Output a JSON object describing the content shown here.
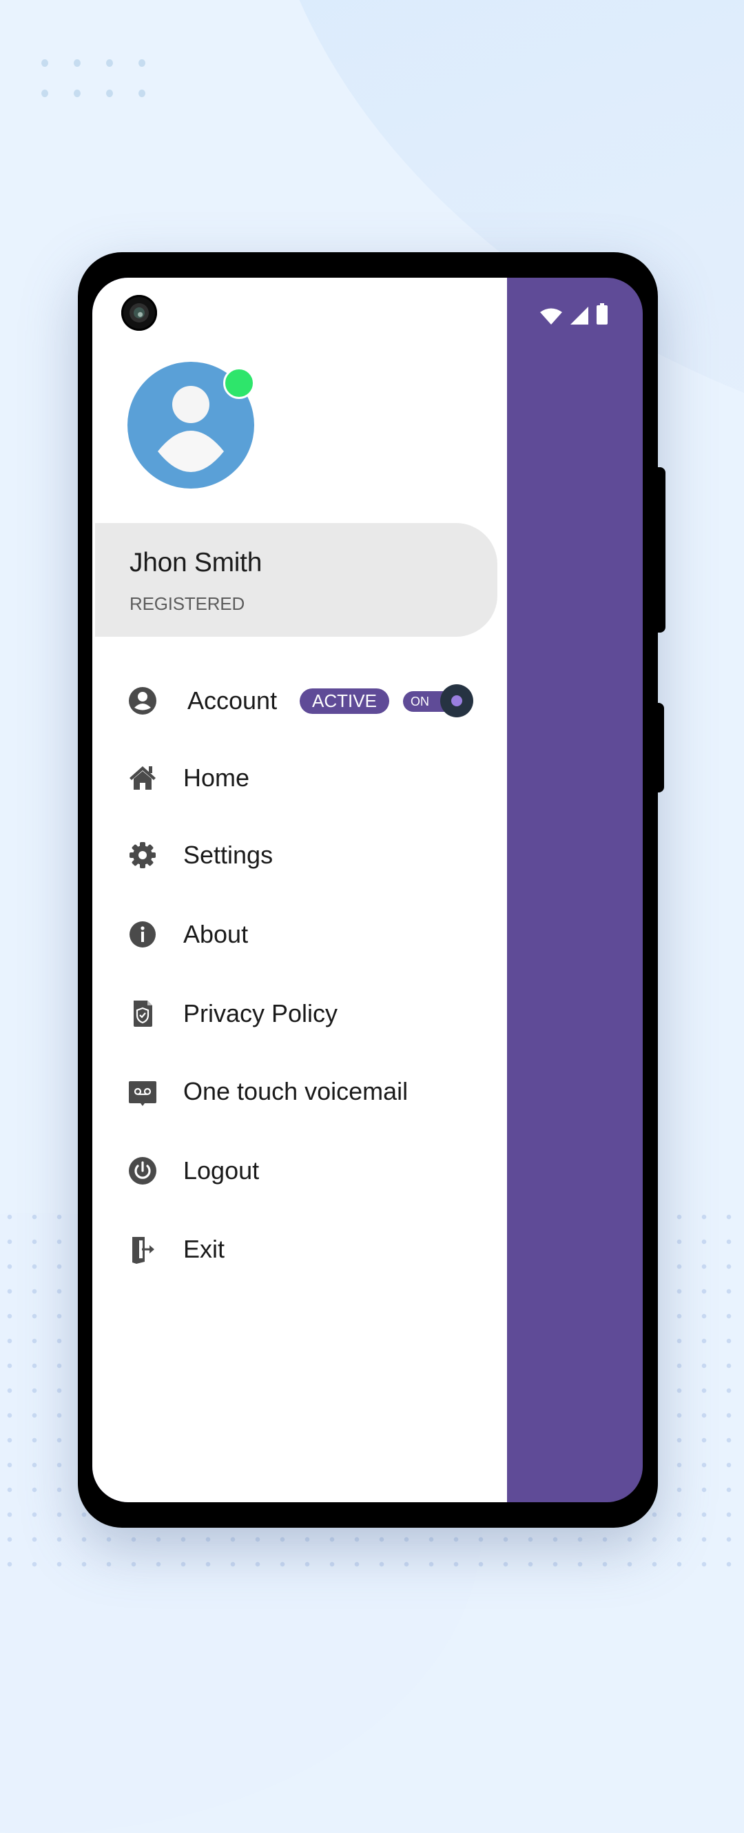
{
  "status_bar": {
    "icons": [
      "wifi-icon",
      "cellular-signal-icon",
      "battery-icon"
    ]
  },
  "profile": {
    "name": "Jhon Smith",
    "status": "REGISTERED",
    "presence": "online",
    "avatar_color": "#5aa0d7",
    "presence_color": "#2ee56b"
  },
  "menu": {
    "account": {
      "label": "Account",
      "icon": "account-circle-icon",
      "badge": "ACTIVE",
      "toggle_label": "ON",
      "toggle_on": true
    },
    "items": [
      {
        "label": "Home",
        "icon": "home-icon"
      },
      {
        "label": "Settings",
        "icon": "gear-icon"
      },
      {
        "label": "About",
        "icon": "info-icon"
      },
      {
        "label": "Privacy Policy",
        "icon": "privacy-policy-icon"
      },
      {
        "label": "One touch voicemail",
        "icon": "voicemail-icon"
      },
      {
        "label": "Logout",
        "icon": "power-icon"
      },
      {
        "label": "Exit",
        "icon": "exit-door-icon"
      }
    ]
  },
  "theme": {
    "accent": "#5f4b97",
    "icon_color": "#4a4a4a",
    "toggle_knob": "#263342",
    "toggle_dot": "#9a7fe0"
  }
}
